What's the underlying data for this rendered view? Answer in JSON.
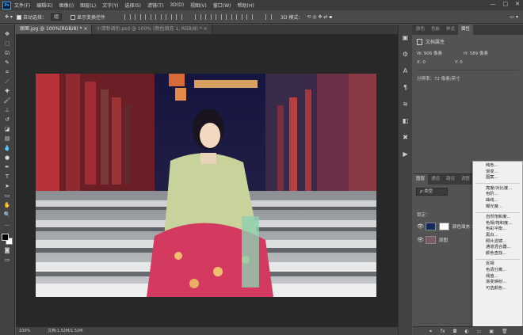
{
  "menubar": {
    "logo": "Ps",
    "items": [
      "文件(F)",
      "编辑(E)",
      "图像(I)",
      "图层(L)",
      "文字(Y)",
      "选择(S)",
      "滤镜(T)",
      "3D(D)",
      "视图(V)",
      "窗口(W)",
      "帮助(H)"
    ],
    "window_controls": [
      "—",
      "□",
      "✕"
    ]
  },
  "options": {
    "auto_select_label": "自动选择：",
    "auto_select_value": "组",
    "transform_label": "显示变换控件"
  },
  "tabs": [
    {
      "label": "原图.jpg @ 100%(RGB/8) *  ×",
      "active": true
    },
    {
      "label": "小清新调色.psd @ 100% (颜色填充 1, RGB/8) *  ×",
      "active": false
    }
  ],
  "status": {
    "zoom": "100%",
    "doc_size": "文档:1.52M/1.52M"
  },
  "panel_tabs": [
    "颜色",
    "色板",
    "样式",
    "属性"
  ],
  "properties": {
    "title": "文档属性",
    "w_label": "W:",
    "w_value": "906 像素",
    "h_label": "H:",
    "h_value": "589 像素",
    "x_label": "X:",
    "x_value": "0",
    "y_label": "Y:",
    "y_value": "0",
    "resolution": "分辨率：72 像素/英寸"
  },
  "layers_tabs": [
    "图层",
    "通道",
    "路径",
    "调整"
  ],
  "layers": {
    "filter_label": "ρ 类型",
    "lock_label": "锁定：",
    "items": [
      {
        "name": "颜色填充 1"
      },
      {
        "name": "原图"
      }
    ]
  },
  "context_menu": {
    "groups": [
      [
        "纯色...",
        "渐变...",
        "图案..."
      ],
      [
        "亮度/对比度...",
        "色阶...",
        "曲线...",
        "曝光度..."
      ],
      [
        "自然饱和度...",
        "色相/饱和度...",
        "色彩平衡...",
        "黑白...",
        "照片滤镜...",
        "通道混合器...",
        "颜色查找..."
      ],
      [
        "反相",
        "色调分离...",
        "阈值...",
        "渐变映射...",
        "可选颜色..."
      ]
    ]
  },
  "colors": {
    "accent": "#31a8ff",
    "menubar_bg": "#3c3c3c",
    "canvas_bg": "#282828"
  }
}
